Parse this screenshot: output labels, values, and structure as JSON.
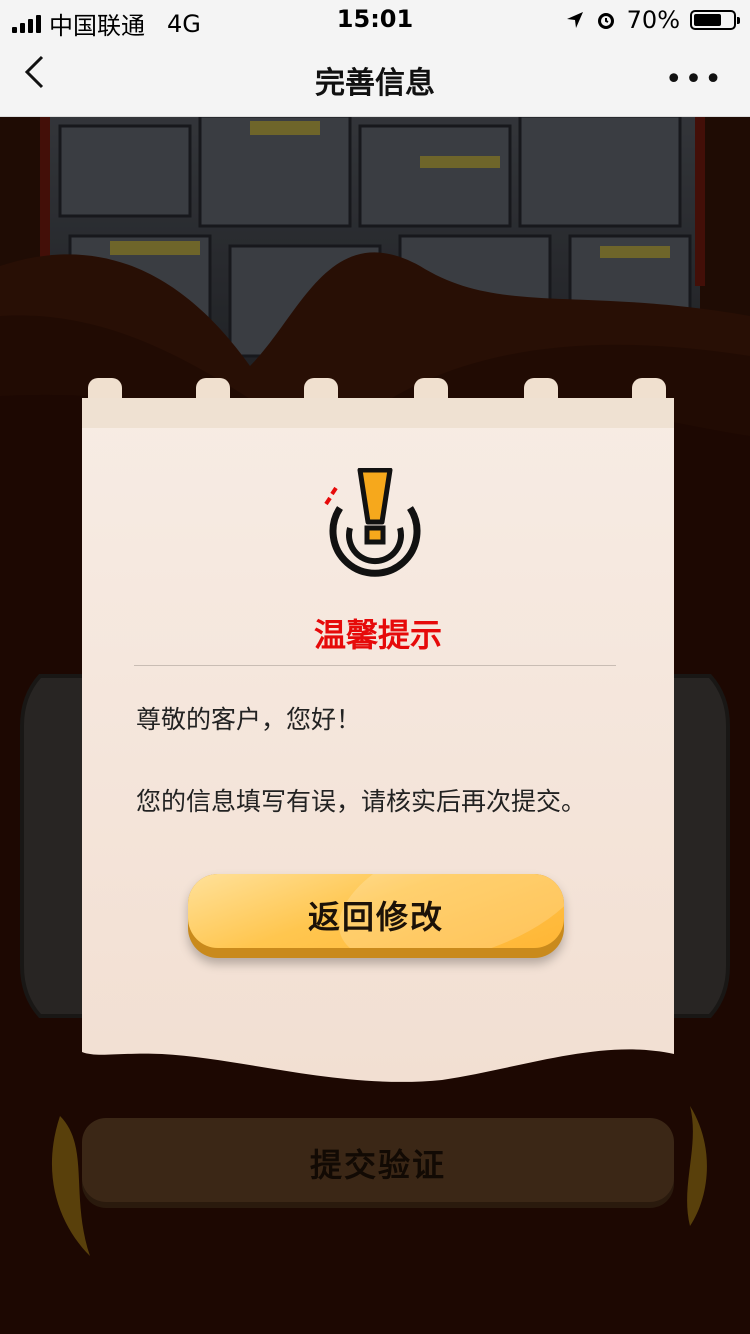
{
  "status_bar": {
    "carrier": "中国联通",
    "network": "4G",
    "time": "15:01",
    "battery": "70%",
    "battery_level": 0.7
  },
  "nav": {
    "back_icon": "chevron-left-icon",
    "title": "完善信息",
    "more_icon": "more-dots-icon",
    "more_glyph": "•••"
  },
  "dialog": {
    "icon": "warning-icon",
    "title": "温馨提示",
    "greeting": "尊敬的客户，您好！",
    "message": "您的信息填写有误，请核实后再次提交。",
    "button_label": "返回修改"
  },
  "page": {
    "submit_label": "提交验证"
  },
  "colors": {
    "title_red": "#e60a0a",
    "button_gold": "#ffc64f",
    "background_brown": "#3a1608",
    "dialog_paper": "#f7e6db"
  }
}
